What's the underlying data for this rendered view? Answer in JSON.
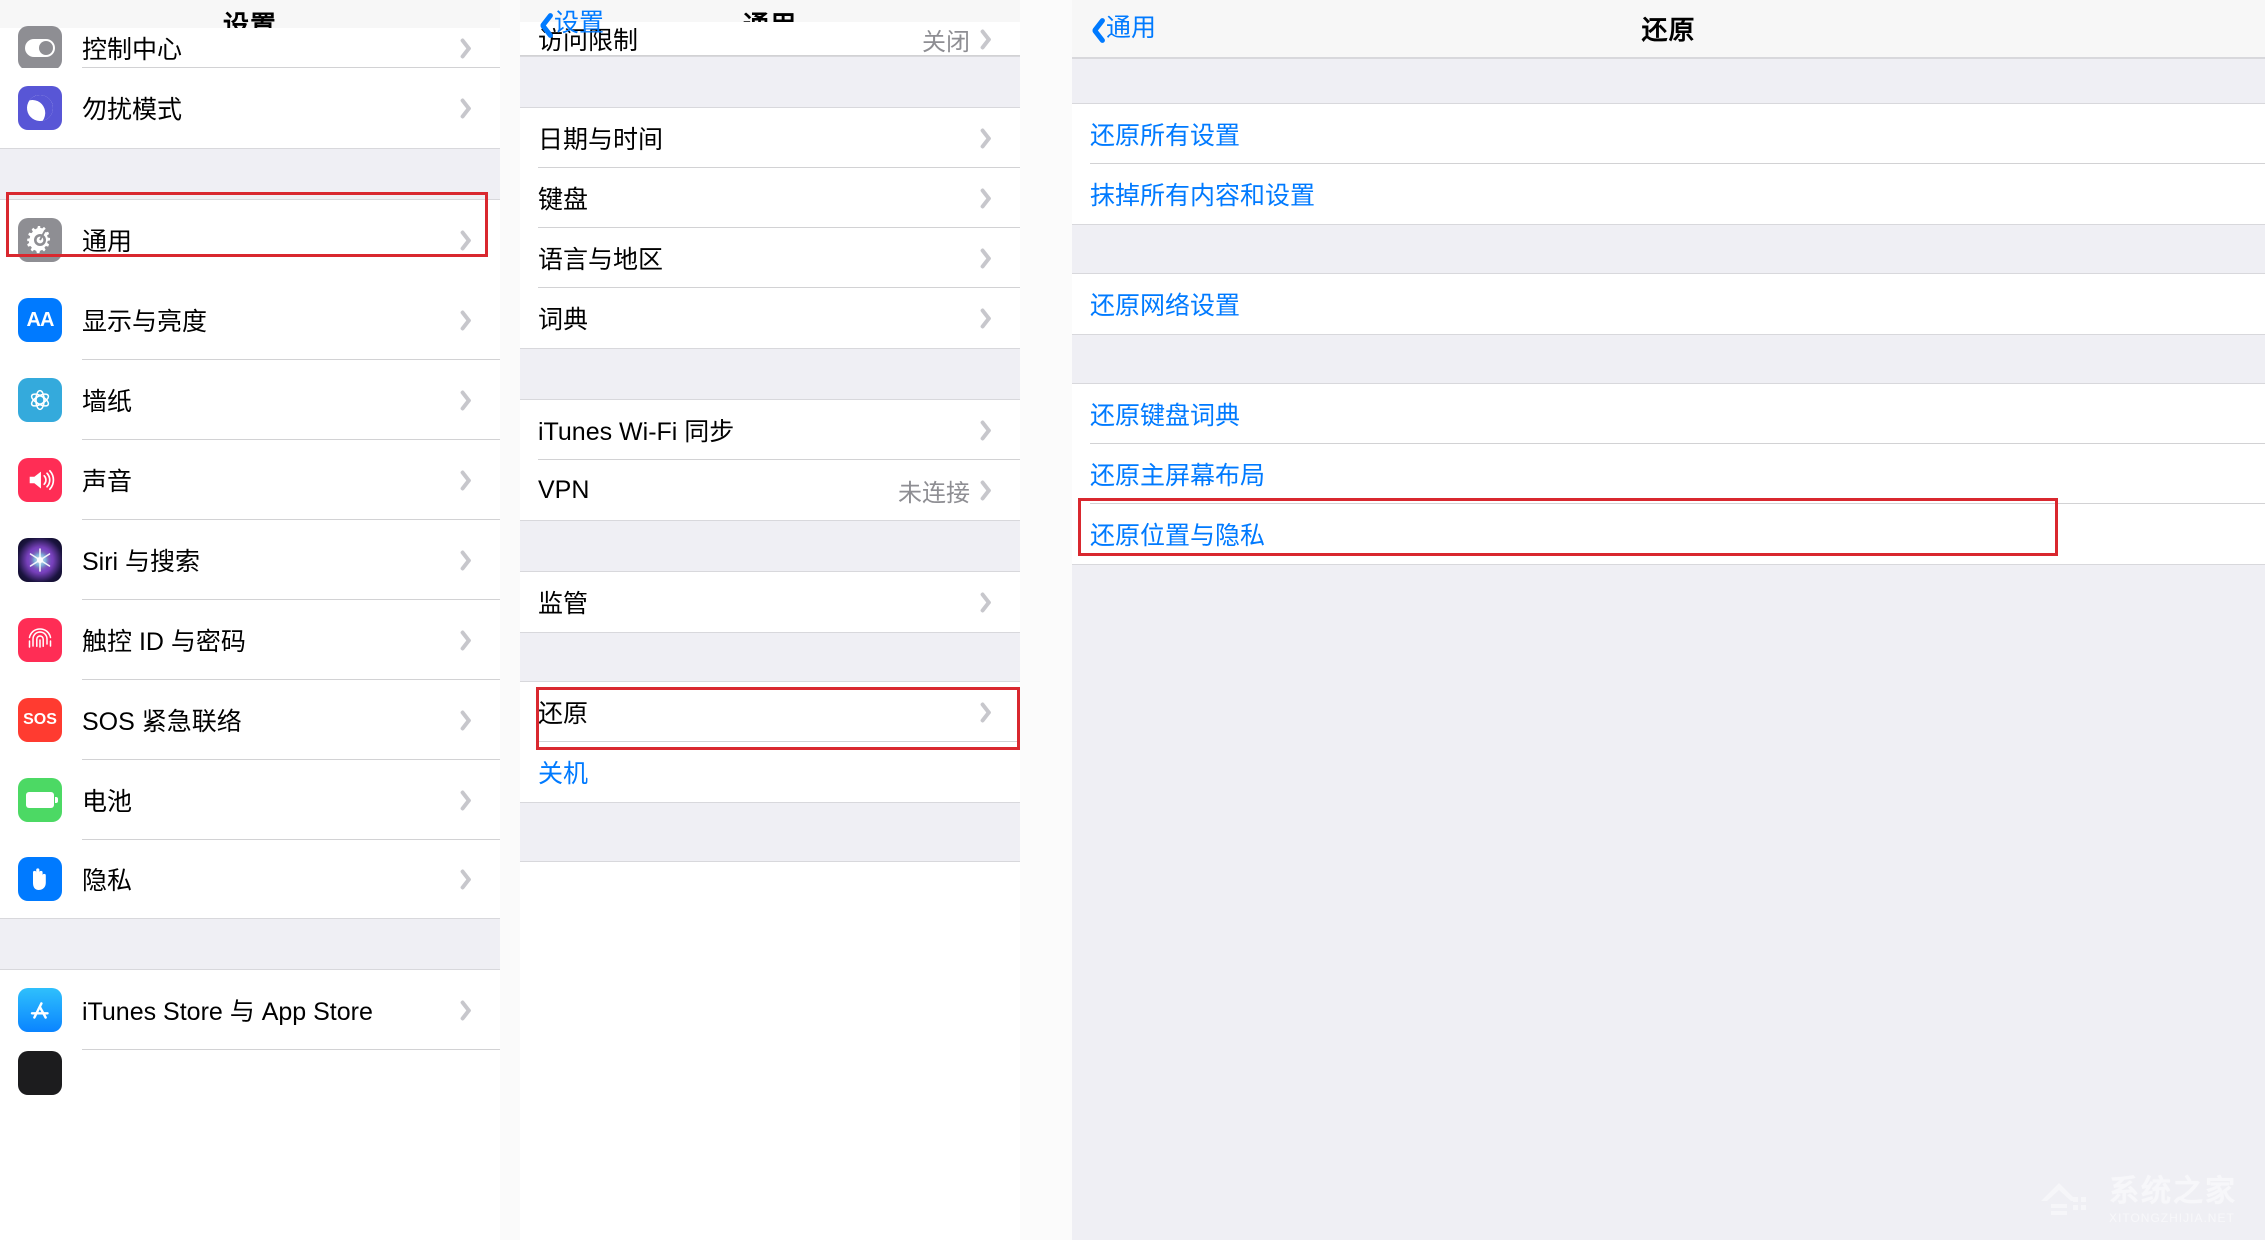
{
  "panels": {
    "left": {
      "nav": {
        "title": "设置"
      },
      "rows": [
        {
          "label": "控制中心",
          "icon": "control-center-icon",
          "value": "",
          "chevron": true,
          "partial": true
        },
        {
          "label": "勿扰模式",
          "icon": "do-not-disturb-icon",
          "value": "",
          "chevron": true
        },
        {
          "label": "通用",
          "icon": "general-gear-icon",
          "value": "",
          "chevron": true,
          "highlight": true
        },
        {
          "label": "显示与亮度",
          "icon": "display-brightness-icon",
          "value": "",
          "chevron": true
        },
        {
          "label": "墙纸",
          "icon": "wallpaper-icon",
          "value": "",
          "chevron": true
        },
        {
          "label": "声音",
          "icon": "sound-icon",
          "value": "",
          "chevron": true
        },
        {
          "label": "Siri 与搜索",
          "icon": "siri-icon",
          "value": "",
          "chevron": true
        },
        {
          "label": "触控 ID 与密码",
          "icon": "touch-id-icon",
          "value": "",
          "chevron": true
        },
        {
          "label": "SOS 紧急联络",
          "icon": "sos-icon",
          "value": "",
          "chevron": true
        },
        {
          "label": "电池",
          "icon": "battery-icon",
          "value": "",
          "chevron": true
        },
        {
          "label": "隐私",
          "icon": "privacy-hand-icon",
          "value": "",
          "chevron": true
        },
        {
          "label": "iTunes Store 与 App Store",
          "icon": "app-store-icon",
          "value": "",
          "chevron": true
        }
      ]
    },
    "middle": {
      "nav": {
        "back_label": "设置",
        "title": "通用"
      },
      "rows": [
        {
          "label": "访问限制",
          "value": "关闭",
          "chevron": true,
          "partial": true
        },
        {
          "label": "日期与时间",
          "value": "",
          "chevron": true
        },
        {
          "label": "键盘",
          "value": "",
          "chevron": true
        },
        {
          "label": "语言与地区",
          "value": "",
          "chevron": true
        },
        {
          "label": "词典",
          "value": "",
          "chevron": true
        },
        {
          "label": "iTunes Wi-Fi 同步",
          "value": "",
          "chevron": true
        },
        {
          "label": "VPN",
          "value": "未连接",
          "chevron": true
        },
        {
          "label": "监管",
          "value": "",
          "chevron": true
        },
        {
          "label": "还原",
          "value": "",
          "chevron": true,
          "highlight": true
        },
        {
          "label": "关机",
          "value": "",
          "chevron": false,
          "blue": true
        }
      ]
    },
    "right": {
      "nav": {
        "back_label": "通用",
        "title": "还原"
      },
      "rows": [
        {
          "label": "还原所有设置",
          "blue": true
        },
        {
          "label": "抹掉所有内容和设置",
          "blue": true
        },
        {
          "label": "还原网络设置",
          "blue": true
        },
        {
          "label": "还原键盘词典",
          "blue": true
        },
        {
          "label": "还原主屏幕布局",
          "blue": true
        },
        {
          "label": "还原位置与隐私",
          "blue": true,
          "highlight": true
        }
      ]
    }
  },
  "watermark": {
    "brand": "系统之家",
    "domain": "XITONGZHIJIA.NET"
  },
  "colors": {
    "accent_blue": "#007aff",
    "highlight_red": "#d9282f",
    "group_bg": "#efeff4",
    "separator": "#d2d2d4",
    "secondary_text": "#8e8e93"
  }
}
